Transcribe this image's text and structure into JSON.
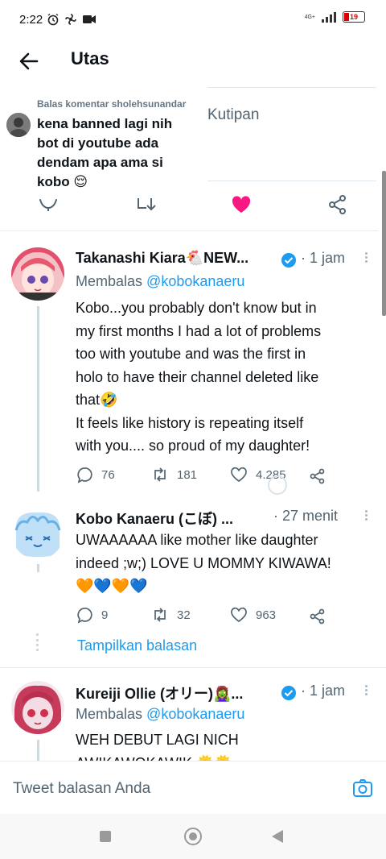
{
  "status_bar": {
    "time": "2:22",
    "network": "4G+",
    "battery": "19",
    "icons": [
      "alarm-icon",
      "fan-icon",
      "video-icon"
    ]
  },
  "header": {
    "title": "Utas"
  },
  "quote_card": {
    "label": "Kutipan"
  },
  "reply_card": {
    "context": "Balas komentar sholehsunandar",
    "text": "kena banned lagi nih\nbot di youtube ada\ndendam apa ama si\nkobo 😌"
  },
  "tweets": [
    {
      "name": "Takanashi Kiara🐔NEW...",
      "time": "· 1 jam",
      "reply_prefix": "Membalas",
      "reply_handle": "@kobokanaeru",
      "text": "Kobo...you probably don't know but in\nmy first months I had a lot of problems\ntoo with youtube and was the first in\nholo to have their channel deleted like\nthat🤣\nIt feels like history is repeating itself\nwith you.... so proud of my daughter!",
      "replies": "76",
      "retweets": "181",
      "likes": "4.285"
    },
    {
      "name": "Kobo Kanaeru (こぼ) ...",
      "time": "· 27 menit",
      "text": "UWAAAAAA like mother like daughter\nindeed ;w;) LOVE U MOMMY KIWAWA!\n🧡💙🧡💙",
      "replies": "9",
      "retweets": "32",
      "likes": "963",
      "show_replies": "Tampilkan balasan"
    },
    {
      "name": "Kureiji Ollie (オリー)🧟‍♀️...",
      "time": "· 1 jam",
      "reply_prefix": "Membalas",
      "reply_handle": "@kobokanaeru",
      "text": "WEH DEBUT LAGI NICH\nAWIKAWOKAWIK 🌞🌞"
    }
  ],
  "reply_bar": {
    "placeholder": "Tweet balasan Anda"
  },
  "colors": {
    "accent": "#1d9bf0",
    "like_active": "#f91880",
    "text_secondary": "#536471"
  }
}
